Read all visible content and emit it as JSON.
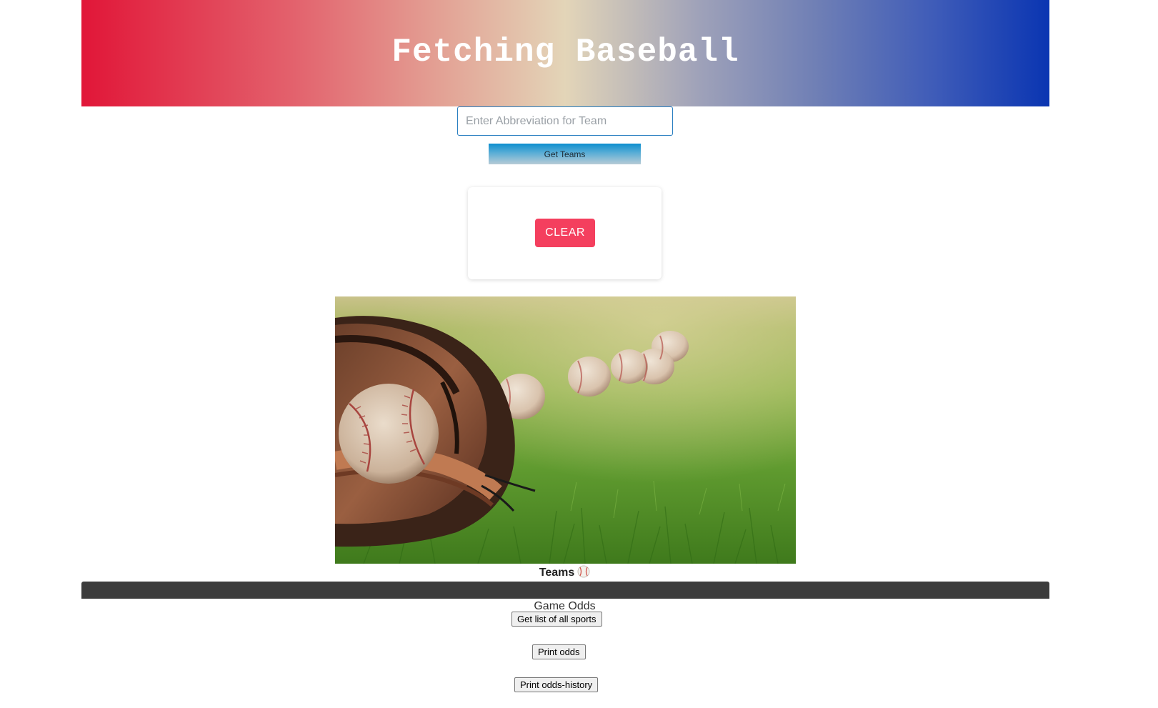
{
  "header": {
    "title": "Fetching Baseball"
  },
  "search": {
    "placeholder": "Enter Abbreviation for Team",
    "value": ""
  },
  "get_teams_label": "Get Teams",
  "clear_label": "CLEAR",
  "teams_heading": "Teams",
  "odds": {
    "title": "Game Odds",
    "buttons": [
      "Get list of all sports",
      "Print odds",
      "Print odds-history"
    ]
  },
  "colors": {
    "header_gradient": [
      "#e11638",
      "#e3d5b8",
      "#0a35b2"
    ],
    "clear_button": "#f43f5e",
    "dark_bar": "#3c3c3c"
  },
  "icons": {
    "teams": "baseball-icon"
  }
}
